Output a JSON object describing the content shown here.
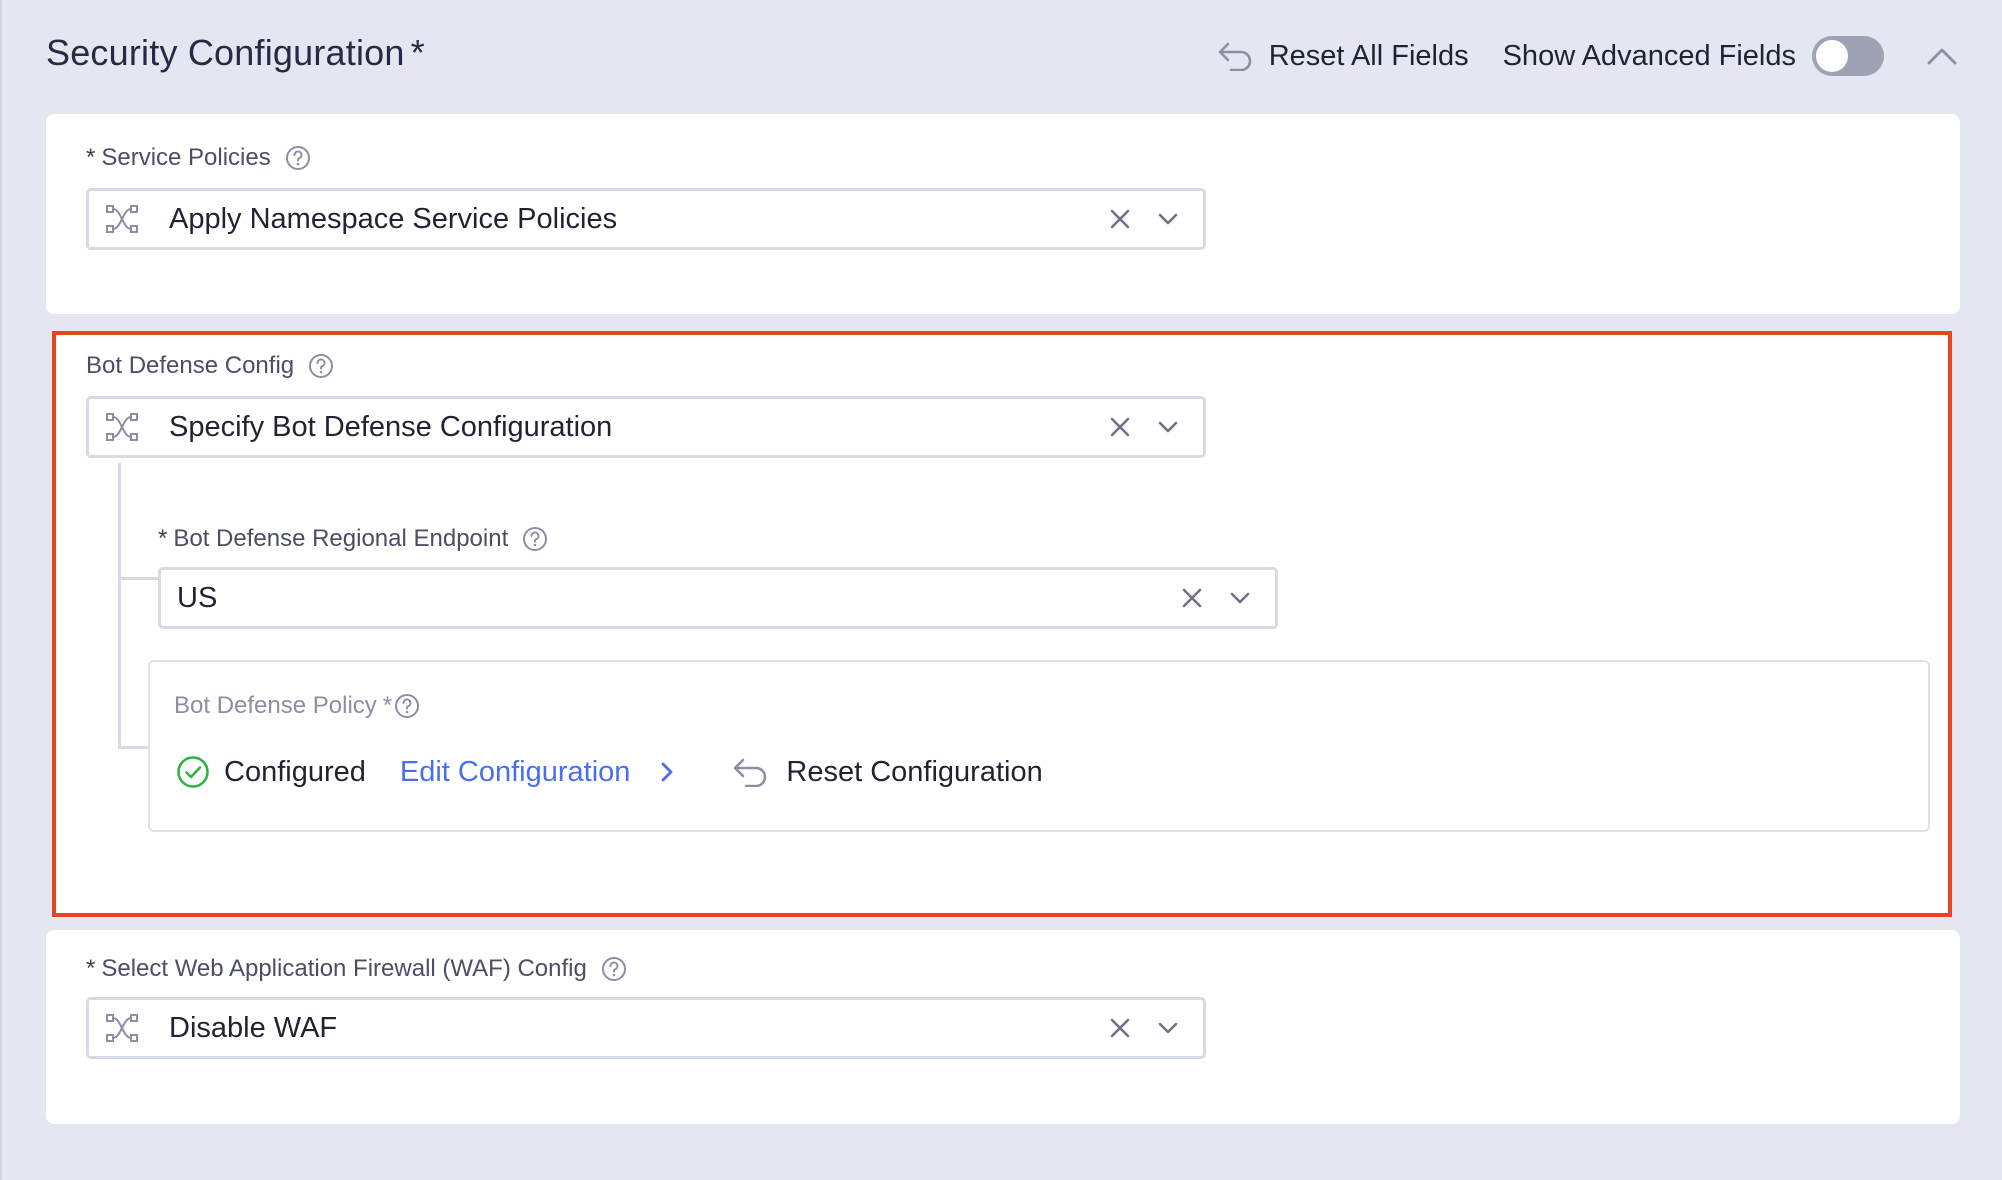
{
  "header": {
    "title": "Security Configuration",
    "required_mark": "*",
    "reset_all_label": "Reset All Fields",
    "show_advanced_label": "Show Advanced Fields",
    "show_advanced_enabled": false
  },
  "service_policies": {
    "required_mark": "*",
    "label": "Service Policies",
    "value": "Apply Namespace Service Policies"
  },
  "bot_defense": {
    "label": "Bot Defense Config",
    "value": "Specify Bot Defense Configuration",
    "regional_endpoint": {
      "required_mark": "*",
      "label": "Bot Defense Regional Endpoint",
      "value": "US"
    },
    "policy": {
      "label": "Bot Defense Policy",
      "required_mark": "*",
      "status": "Configured",
      "edit_label": "Edit Configuration",
      "reset_label": "Reset Configuration"
    }
  },
  "waf": {
    "required_mark": "*",
    "label": "Select Web Application Firewall (WAF) Config",
    "value": "Disable WAF"
  },
  "colors": {
    "background": "#e4e6f1",
    "highlight_border": "#e5461f",
    "link": "#4a6ef0",
    "success": "#2fb344"
  }
}
